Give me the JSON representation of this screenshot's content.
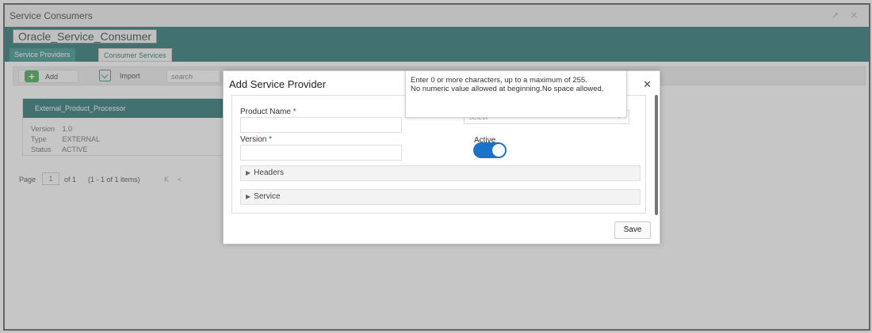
{
  "window": {
    "title": "Service Consumers",
    "controls": "↗ ✕"
  },
  "banner": {
    "name": "Oracle_Service_Consumer"
  },
  "tabs": [
    {
      "label": "Service Providers",
      "active": true
    },
    {
      "label": "Consumer Services",
      "active": false
    }
  ],
  "toolbar": {
    "add_label": "Add",
    "import_label": "Import",
    "search_placeholder": "search"
  },
  "card": {
    "title": "External_Product_Processor",
    "rows": [
      {
        "key": "Version",
        "value": "1.0"
      },
      {
        "key": "Type",
        "value": "EXTERNAL"
      },
      {
        "key": "Status",
        "value": "ACTIVE"
      }
    ]
  },
  "pager": {
    "page_label": "Page",
    "page_value": "1",
    "of_label": "of 1",
    "items_label": "(1 - 1 of 1 items)",
    "first_icon": "K",
    "prev_icon": "<"
  },
  "dialog": {
    "title": "Add Service Provider",
    "close": "✕",
    "product_name_label": "Product Name",
    "version_label": "Version",
    "required_marker": "*",
    "select_placeholder": "select",
    "active_label": "Active",
    "active_value": true,
    "sections": [
      "Headers",
      "Service"
    ],
    "save_label": "Save"
  },
  "tooltip": {
    "line1": "Enter 0 or more characters, up to a maximum of 255.",
    "line2": "No numeric value allowed at beginning.No space allowed."
  },
  "colors": {
    "brand_teal": "#1c6e6b",
    "toggle_blue": "#1a73c9",
    "add_green": "#3aa54b"
  }
}
